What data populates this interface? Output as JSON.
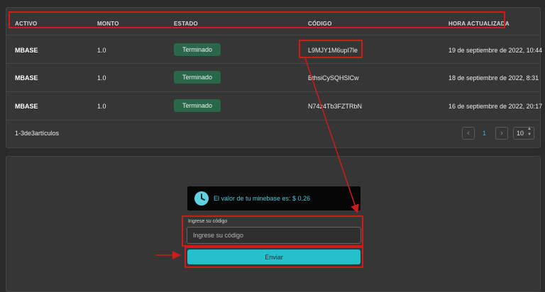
{
  "table": {
    "headers": [
      "ACTIVO",
      "MONTO",
      "ESTADO",
      "CÓDIGO",
      "HORA ACTUALIZADA"
    ],
    "rows": [
      {
        "asset": "MBASE",
        "amount": "1.0",
        "status": "Terminado",
        "code": "L9MJY1M6upI7le",
        "time": "19 de septiembre de 2022, 10:44"
      },
      {
        "asset": "MBASE",
        "amount": "1.0",
        "status": "Terminado",
        "code": "BthsiCySQHSlCw",
        "time": "18 de septiembre de 2022, 8:31"
      },
      {
        "asset": "MBASE",
        "amount": "1.0",
        "status": "Terminado",
        "code": "N74z4Tb3FZTRbN",
        "time": "16 de septiembre de 2022, 20:17"
      }
    ],
    "summary": "1-3de3artículos"
  },
  "pagination": {
    "prev_icon": "chevron-left-icon",
    "current_page": "1",
    "next_icon": "chevron-right-icon",
    "page_size": "10"
  },
  "redeem": {
    "info_text": "El valor de tu minebase es: $ 0.26",
    "field_label": "Ingrese su código",
    "field_placeholder": "Ingrese su código",
    "field_value": "",
    "submit_label": "Enviar"
  },
  "colors": {
    "badge": "#2a6649",
    "accent": "#25c0cb",
    "annotation": "#d11a1a"
  }
}
